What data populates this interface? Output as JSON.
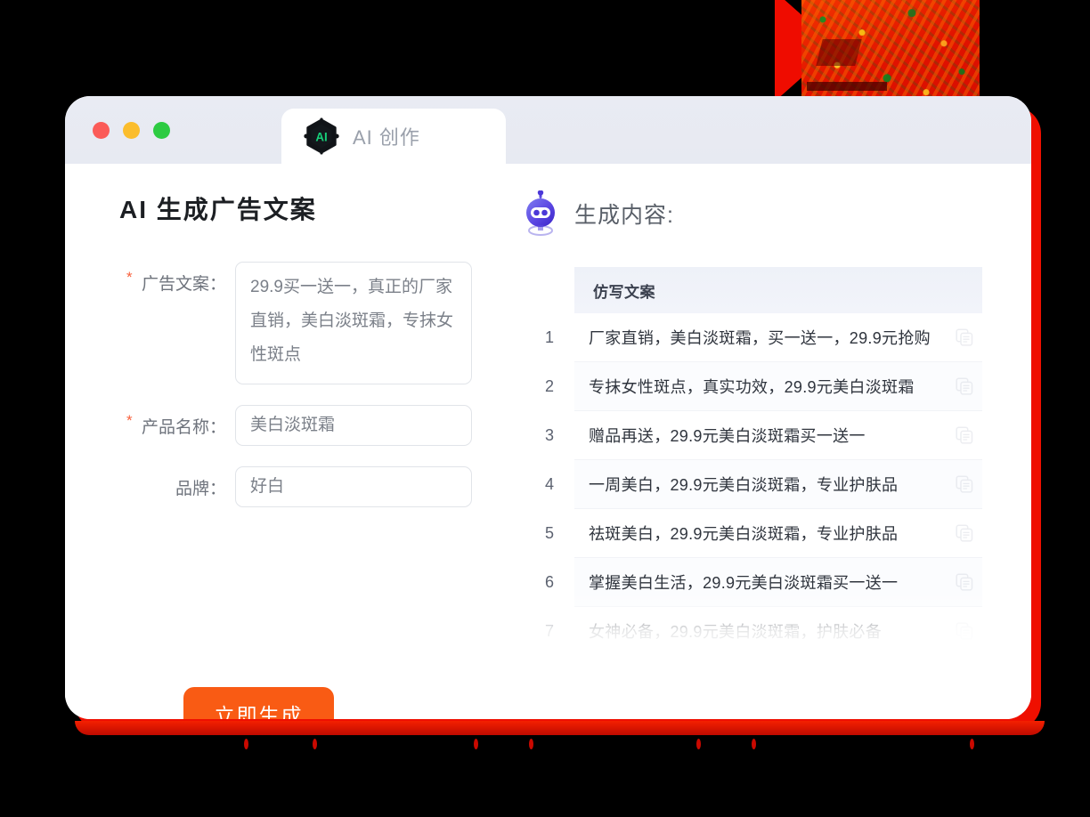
{
  "window": {
    "traffic_lights": [
      {
        "name": "close",
        "color": "#fb5b58"
      },
      {
        "name": "minimize",
        "color": "#fbbd2d"
      },
      {
        "name": "maximize",
        "color": "#2dcb42"
      }
    ],
    "tab_label": "AI 创作",
    "logo_text": "AI"
  },
  "form": {
    "title": "AI 生成广告文案",
    "fields": [
      {
        "label": "广告文案：",
        "required": true,
        "type": "textarea",
        "value": "29.9买一送一，真正的厂家直销，美白淡斑霜，专抹女性斑点"
      },
      {
        "label": "产品名称：",
        "required": true,
        "type": "input",
        "value": "美白淡斑霜"
      },
      {
        "label": "品牌：",
        "required": false,
        "type": "input",
        "value": "好白"
      }
    ],
    "submit_label": "立即生成"
  },
  "results": {
    "heading": "生成内容:",
    "column_header": "仿写文案",
    "copy_icon": "copy-icon",
    "rows": [
      {
        "num": "1",
        "text": "厂家直销，美白淡斑霜，买一送一，29.9元抢购"
      },
      {
        "num": "2",
        "text": "专抹女性斑点，真实功效，29.9元美白淡斑霜"
      },
      {
        "num": "3",
        "text": "赠品再送，29.9元美白淡斑霜买一送一"
      },
      {
        "num": "4",
        "text": "一周美白，29.9元美白淡斑霜，专业护肤品"
      },
      {
        "num": "5",
        "text": "祛斑美白，29.9元美白淡斑霜，专业护肤品"
      },
      {
        "num": "6",
        "text": "掌握美白生活，29.9元美白淡斑霜买一送一"
      },
      {
        "num": "7",
        "text": "女神必备，29.9元美白淡斑霜，护肤必备"
      }
    ]
  },
  "colors": {
    "accent_orange": "#f95b14",
    "required_star": "#f8603c",
    "logo_green": "#17d07a",
    "robot_purple": "#5b4ae0",
    "background": "#000000",
    "glow_red": "#ef0f00",
    "titlebar": "#e8eaf2"
  }
}
